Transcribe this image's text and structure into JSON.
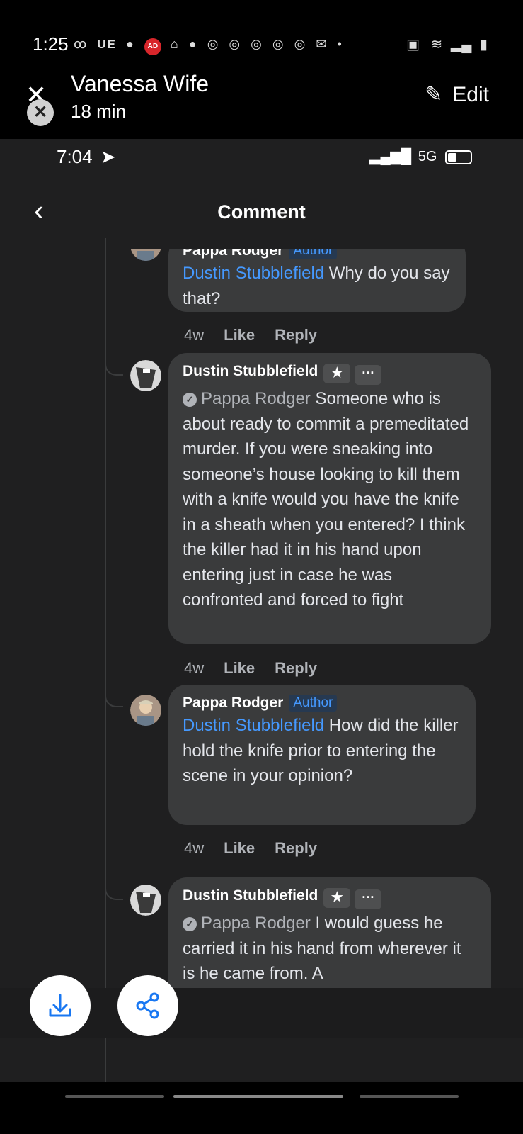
{
  "outer_status": {
    "time": "1:25",
    "left_icons": [
      "voicemail-icon",
      "UE",
      "messenger-icon",
      "AD",
      "home-icon",
      "reddit-icon",
      "instagram-icon",
      "instagram-icon",
      "instagram-icon",
      "instagram-icon",
      "instagram-icon",
      "gmail-icon",
      "dot"
    ]
  },
  "story": {
    "title": "Vanessa Wife",
    "subtitle": "18 min",
    "edit_label": "Edit"
  },
  "inner_status": {
    "time": "7:04",
    "network": "5G"
  },
  "nav": {
    "title": "Comment"
  },
  "comments": [
    {
      "author": "Pappa Rodger",
      "badge": "Author",
      "mention": "Dustin Stubblefield",
      "text": " Why do you say that?",
      "age": "4w",
      "like": "Like",
      "reply": "Reply"
    },
    {
      "author": "Dustin Stubblefield",
      "mention": "Pappa Rodger",
      "text": " Someone who is about ready to commit a premeditated murder. If you were sneaking into someone’s house looking to kill them with a knife would you have the knife in a sheath when you entered? I think the killer had it in his hand upon entering just in case he was confronted and forced to fight",
      "age": "4w",
      "like": "Like",
      "reply": "Reply"
    },
    {
      "author": "Pappa Rodger",
      "badge": "Author",
      "mention": "Dustin Stubblefield",
      "text": " How did the killer hold the knife prior to entering the scene in your opinion?",
      "age": "4w",
      "like": "Like",
      "reply": "Reply"
    },
    {
      "author": "Dustin Stubblefield",
      "mention": "Pappa Rodger",
      "text": " I would guess he carried it in his hand from wherever it is he came from. A"
    }
  ],
  "bottom_actions": [
    "download-icon",
    "share-icon"
  ]
}
